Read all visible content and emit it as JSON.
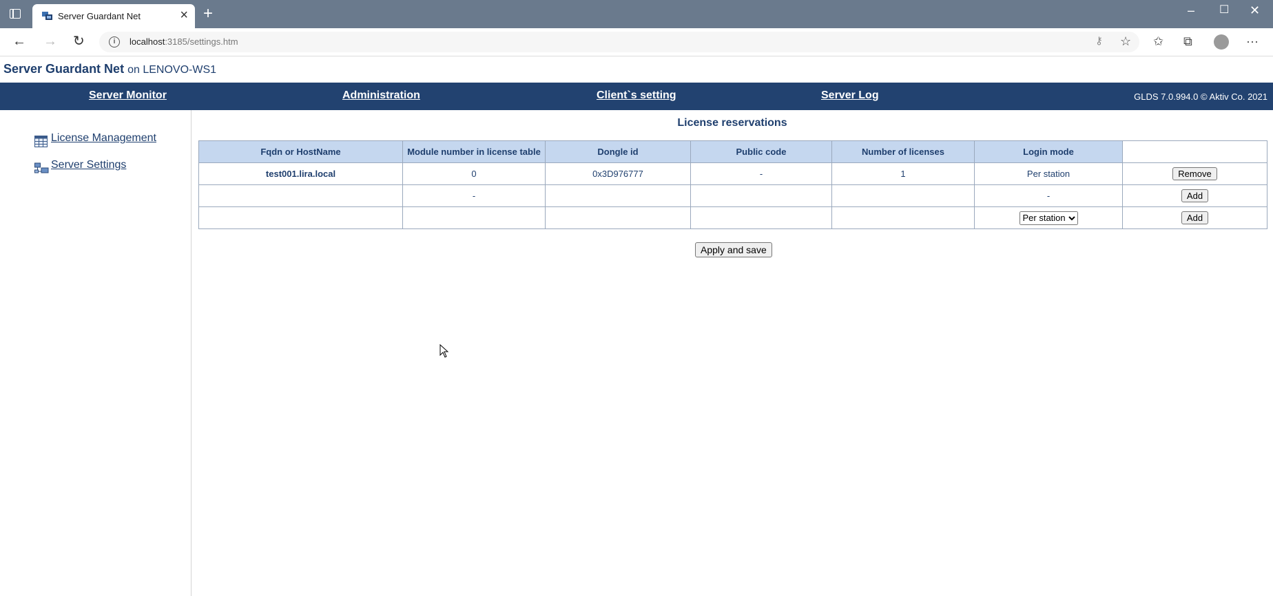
{
  "browser": {
    "tab_title": "Server Guardant Net",
    "url_host": "localhost",
    "url_rest": ":3185/settings.htm"
  },
  "header": {
    "app_name": "Server Guardant Net",
    "host_text": "on LENOVO-WS1"
  },
  "nav": {
    "items": [
      "Server Monitor",
      "Administration",
      "Client`s setting",
      "Server Log"
    ],
    "version": "GLDS 7.0.994.0 © Aktiv Co. 2021"
  },
  "sidebar": {
    "items": [
      {
        "label": "License Management",
        "icon": "table-icon"
      },
      {
        "label": "Server Settings",
        "icon": "network-servers-icon"
      }
    ]
  },
  "main": {
    "title": "License reservations",
    "columns": [
      "Fqdn or HostName",
      "Module number in license table",
      "Dongle id",
      "Public code",
      "Number of licenses",
      "Login mode",
      ""
    ],
    "rows": [
      {
        "host": "test001.lira.local",
        "module": "0",
        "dongle": "0x3D976777",
        "public_code": "-",
        "count": "1",
        "login_mode": "Per station",
        "action": "Remove"
      },
      {
        "host": "",
        "module": "-",
        "dongle": "",
        "public_code": "",
        "count": "",
        "login_mode": "-",
        "action": "Add"
      },
      {
        "host": "",
        "module": "",
        "dongle": "",
        "public_code": "",
        "count": "",
        "login_mode_select": "Per station",
        "action": "Add"
      }
    ],
    "apply_label": "Apply and save"
  }
}
